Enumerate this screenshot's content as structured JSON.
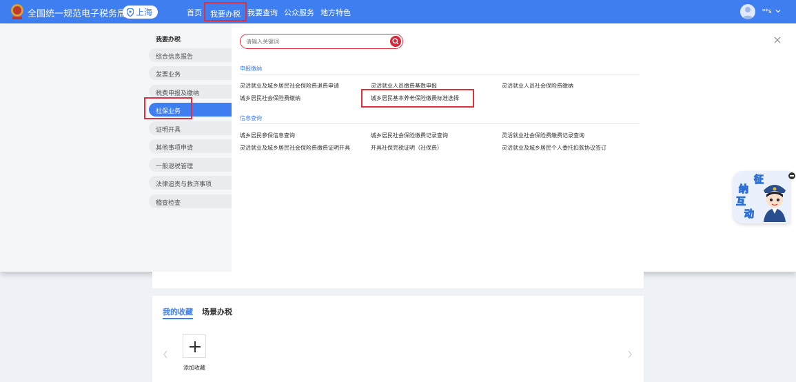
{
  "header": {
    "brand": "全国统一规范电子税务局",
    "region": "上海",
    "nav": [
      "首页",
      "我要办税",
      "我要查询",
      "公众服务",
      "地方特色"
    ],
    "active_nav": "我要办税",
    "username": "**s"
  },
  "panel": {
    "left_title": "我要办税",
    "menu": [
      "综合信息报告",
      "发票业务",
      "税费申报及缴纳",
      "社保业务",
      "证明开具",
      "其他事项申请",
      "一般退税管理",
      "法律追责与救济事项",
      "稽查检查"
    ],
    "active_menu": "社保业务",
    "search_placeholder": "请输入关键词",
    "sections": [
      {
        "title": "申报缴纳",
        "links": [
          "灵活就业及城乡居民社会保险费退费申请",
          "灵活就业人员缴费基数申报",
          "灵活就业人员社会保险费缴纳",
          "城乡居民社会保险费缴纳",
          "城乡居民基本养老保险缴费标准选择"
        ]
      },
      {
        "title": "信息查询",
        "links": [
          "城乡居民参保信息查询",
          "城乡居民社会保险缴费记录查询",
          "灵活就业社会保险费缴费记录查询",
          "灵活就业及城乡居民社会保险费缴费证明开具",
          "开具社保完税证明（社保费）",
          "灵活就业及城乡居民个人委托扣款协议签订"
        ]
      }
    ]
  },
  "mascot": {
    "chars": [
      "征",
      "纳",
      "互",
      "动"
    ]
  },
  "favorites": {
    "tabs": [
      "我的收藏",
      "场景办税"
    ],
    "add_label": "添加收藏"
  },
  "colors": {
    "primary": "#3f7ef0",
    "highlight": "#e0303d"
  }
}
